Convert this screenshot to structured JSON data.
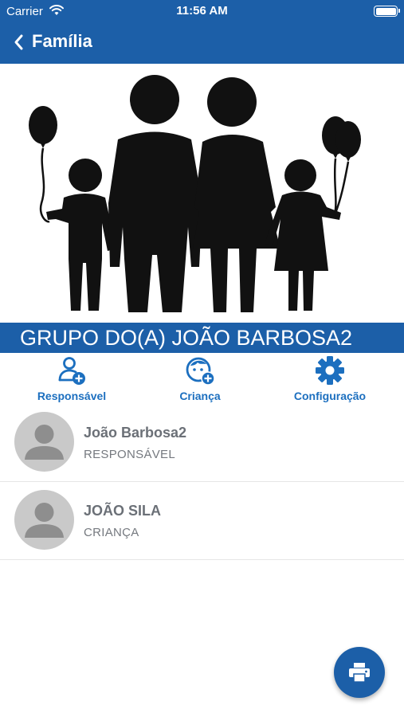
{
  "status_bar": {
    "carrier": "Carrier",
    "time": "11:56 AM",
    "wifi_icon": "wifi-icon",
    "battery_icon": "battery-icon"
  },
  "navbar": {
    "title": "Família",
    "back_icon": "chevron-left-icon"
  },
  "hero": {
    "image": "family-illustration"
  },
  "group": {
    "title": "GRUPO DO(A) JOÃO BARBOSA2"
  },
  "actions": [
    {
      "label": "Responsável",
      "icon": "add-person-icon"
    },
    {
      "label": "Criança",
      "icon": "add-child-icon"
    },
    {
      "label": "Configuração",
      "icon": "gear-icon"
    }
  ],
  "members": [
    {
      "name": "João Barbosa2",
      "role": "RESPONSÁVEL",
      "avatar": "default-avatar-icon"
    },
    {
      "name": "JOÃO SILA",
      "role": "CRIANÇA",
      "avatar": "default-avatar-icon"
    }
  ],
  "fab": {
    "icon": "print-icon"
  },
  "colors": {
    "primary": "#1c5fa8",
    "accent": "#1c6fbf",
    "text_muted": "#6b7077",
    "avatar_bg": "#c9c9c9"
  }
}
